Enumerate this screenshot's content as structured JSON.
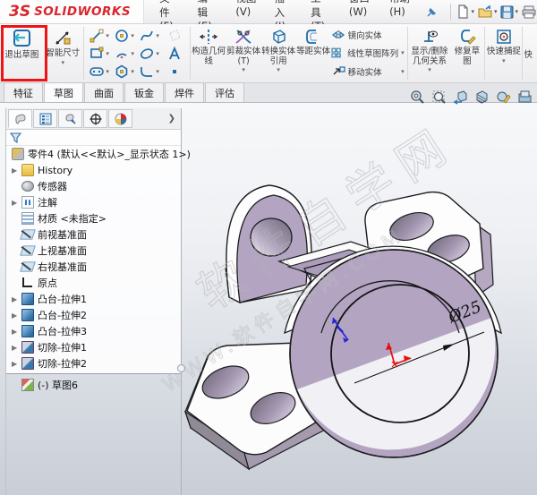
{
  "window": {
    "brand_mark": "3S",
    "brand": "SOLIDWORKS"
  },
  "menubar": {
    "items": [
      "文件(F)",
      "编辑(E)",
      "视图(V)",
      "插入(I)",
      "工具(T)",
      "窗口(W)",
      "帮助(H)"
    ]
  },
  "quickbar": {
    "icons": [
      "new-document",
      "open-document",
      "save",
      "print"
    ]
  },
  "ribbon": {
    "exit_sketch": "退出草图",
    "smart_dimension": "智能尺寸",
    "construction_geometry": "构造几何线",
    "trim_entities": "剪裁实体(T)",
    "convert_entities": "转换实体引用",
    "offset_entities": "等距实体",
    "mirror_entities": "镜向实体",
    "linear_pattern": "线性草图阵列",
    "move_entities": "移动实体",
    "display_delete_relations": "显示/删除几何关系",
    "repair_sketch": "修复草图",
    "quick_snaps": "快速捕捉",
    "clipped_button": "快",
    "entity_tools": [
      "line",
      "rectangle",
      "slot",
      "circle",
      "arc",
      "polygon",
      "spline",
      "ellipse",
      "sketch-fillet",
      "text",
      "point"
    ]
  },
  "tabs": {
    "items": [
      "特征",
      "草图",
      "曲面",
      "钣金",
      "焊件",
      "评估"
    ],
    "active": "草图"
  },
  "feature_tree": {
    "root": "零件4 (默认<<默认>_显示状态 1>)",
    "items": [
      {
        "label": "History",
        "icon": "history-folder",
        "expandable": true
      },
      {
        "label": "传感器",
        "icon": "sensors",
        "expandable": false
      },
      {
        "label": "注解",
        "icon": "annotations",
        "expandable": true
      },
      {
        "label": "材质 <未指定>",
        "icon": "material",
        "expandable": false
      },
      {
        "label": "前视基准面",
        "icon": "plane",
        "expandable": false
      },
      {
        "label": "上视基准面",
        "icon": "plane",
        "expandable": false
      },
      {
        "label": "右视基准面",
        "icon": "plane",
        "expandable": false
      },
      {
        "label": "原点",
        "icon": "origin",
        "expandable": false
      },
      {
        "label": "凸台-拉伸1",
        "icon": "boss-extrude",
        "expandable": true
      },
      {
        "label": "凸台-拉伸2",
        "icon": "boss-extrude",
        "expandable": true
      },
      {
        "label": "凸台-拉伸3",
        "icon": "boss-extrude",
        "expandable": true
      },
      {
        "label": "切除-拉伸1",
        "icon": "cut-extrude",
        "expandable": true
      },
      {
        "label": "切除-拉伸2",
        "icon": "cut-extrude",
        "expandable": true
      },
      {
        "label": "(-) 草图6",
        "icon": "sketch",
        "expandable": false
      }
    ]
  },
  "viewport": {
    "dimension_label": "Ø25",
    "watermark_title": "软件自学网",
    "watermark_url": "WWW.软件自学网.COM"
  },
  "hud_icons": [
    "zoom-fit",
    "zoom-area",
    "previous-view",
    "section-view",
    "appearance",
    "scene"
  ],
  "colors": {
    "highlight_red": "#ec1414",
    "brand_red": "#d8262c",
    "icon_blue": "#1d6ca6",
    "icon_gold": "#d9a441",
    "model_lavender": "#b3a5c2"
  }
}
